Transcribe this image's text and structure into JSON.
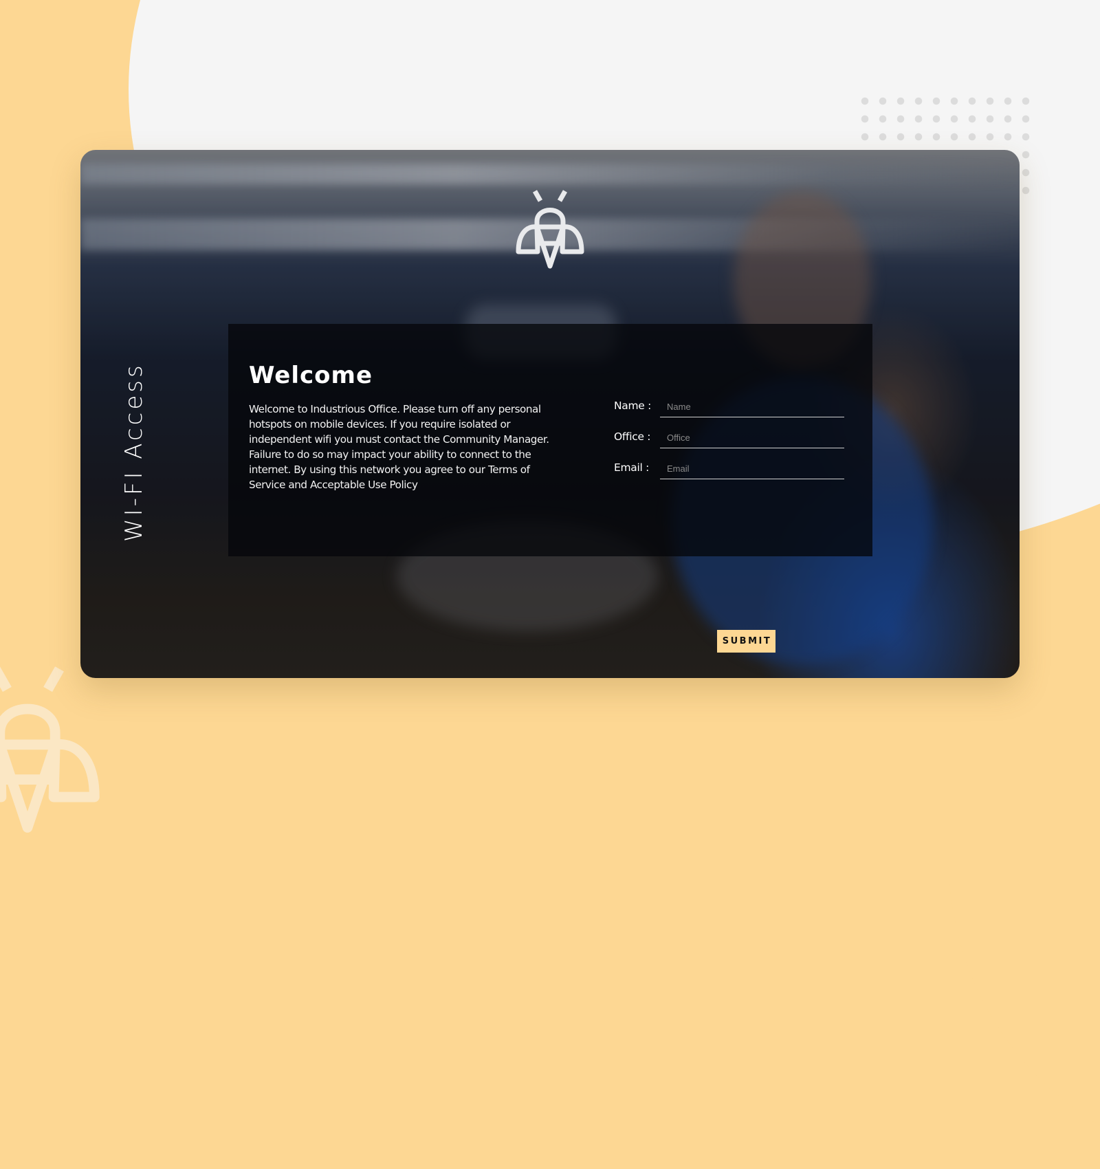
{
  "page": {
    "vertical_title": "WI-FI Access",
    "logo_icon": "bee-icon"
  },
  "welcome": {
    "title": "Welcome",
    "body": "Welcome to Industrious Office. Please turn off any personal hotspots on mobile devices. If you require isolated or independent wifi you must contact the Community Manager. Failure to do so may impact your ability to connect to the internet. By using this network you agree to our Terms of Service and Acceptable Use Policy"
  },
  "form": {
    "fields": [
      {
        "label": "Name :",
        "placeholder": "Name",
        "value": ""
      },
      {
        "label": "Office :",
        "placeholder": "Office",
        "value": ""
      },
      {
        "label": "Email :",
        "placeholder": "Email",
        "value": ""
      }
    ],
    "submit_label": "SUBMIT"
  },
  "colors": {
    "accent": "#fdd793",
    "background_light": "#f5f5f5",
    "panel": "#05070a"
  }
}
